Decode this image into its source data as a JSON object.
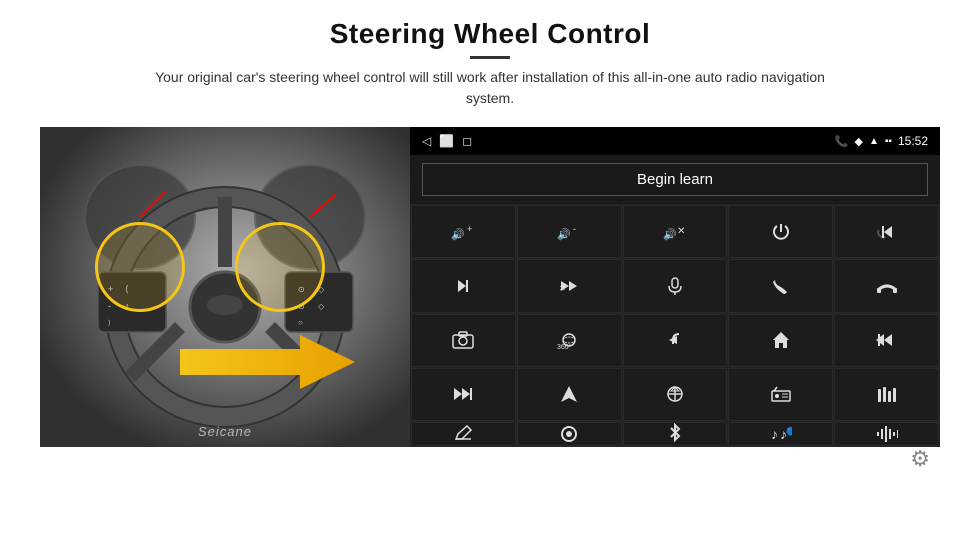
{
  "header": {
    "title": "Steering Wheel Control",
    "subtitle": "Your original car's steering wheel control will still work after installation of this all-in-one auto radio navigation system."
  },
  "status_bar": {
    "time": "15:52",
    "nav_back": "◁",
    "nav_home": "⬜",
    "nav_recent": "◻"
  },
  "begin_learn": {
    "label": "Begin learn"
  },
  "controls": [
    {
      "icon": "🔊+",
      "label": "vol-up"
    },
    {
      "icon": "🔊-",
      "label": "vol-down"
    },
    {
      "icon": "🔇",
      "label": "mute"
    },
    {
      "icon": "⏻",
      "label": "power"
    },
    {
      "icon": "⏮",
      "label": "prev-track"
    },
    {
      "icon": "⏭",
      "label": "next"
    },
    {
      "icon": "⏩",
      "label": "fast-fwd"
    },
    {
      "icon": "🎤",
      "label": "mic"
    },
    {
      "icon": "📞",
      "label": "phone"
    },
    {
      "icon": "↩",
      "label": "hang-up"
    },
    {
      "icon": "📷",
      "label": "camera"
    },
    {
      "icon": "360°",
      "label": "360-view"
    },
    {
      "icon": "↪",
      "label": "back"
    },
    {
      "icon": "🏠",
      "label": "home"
    },
    {
      "icon": "⏮",
      "label": "rewind"
    },
    {
      "icon": "⏭",
      "label": "skip"
    },
    {
      "icon": "▶",
      "label": "nav"
    },
    {
      "icon": "⇄",
      "label": "switch"
    },
    {
      "icon": "📻",
      "label": "radio"
    },
    {
      "icon": "🎛",
      "label": "settings"
    },
    {
      "icon": "✏",
      "label": "edit"
    },
    {
      "icon": "⚙",
      "label": "power2"
    },
    {
      "icon": "🔵",
      "label": "bluetooth"
    },
    {
      "icon": "🎵",
      "label": "music"
    },
    {
      "icon": "📊",
      "label": "equalizer"
    }
  ],
  "watermark": "Seicane",
  "gear_icon": "⚙"
}
